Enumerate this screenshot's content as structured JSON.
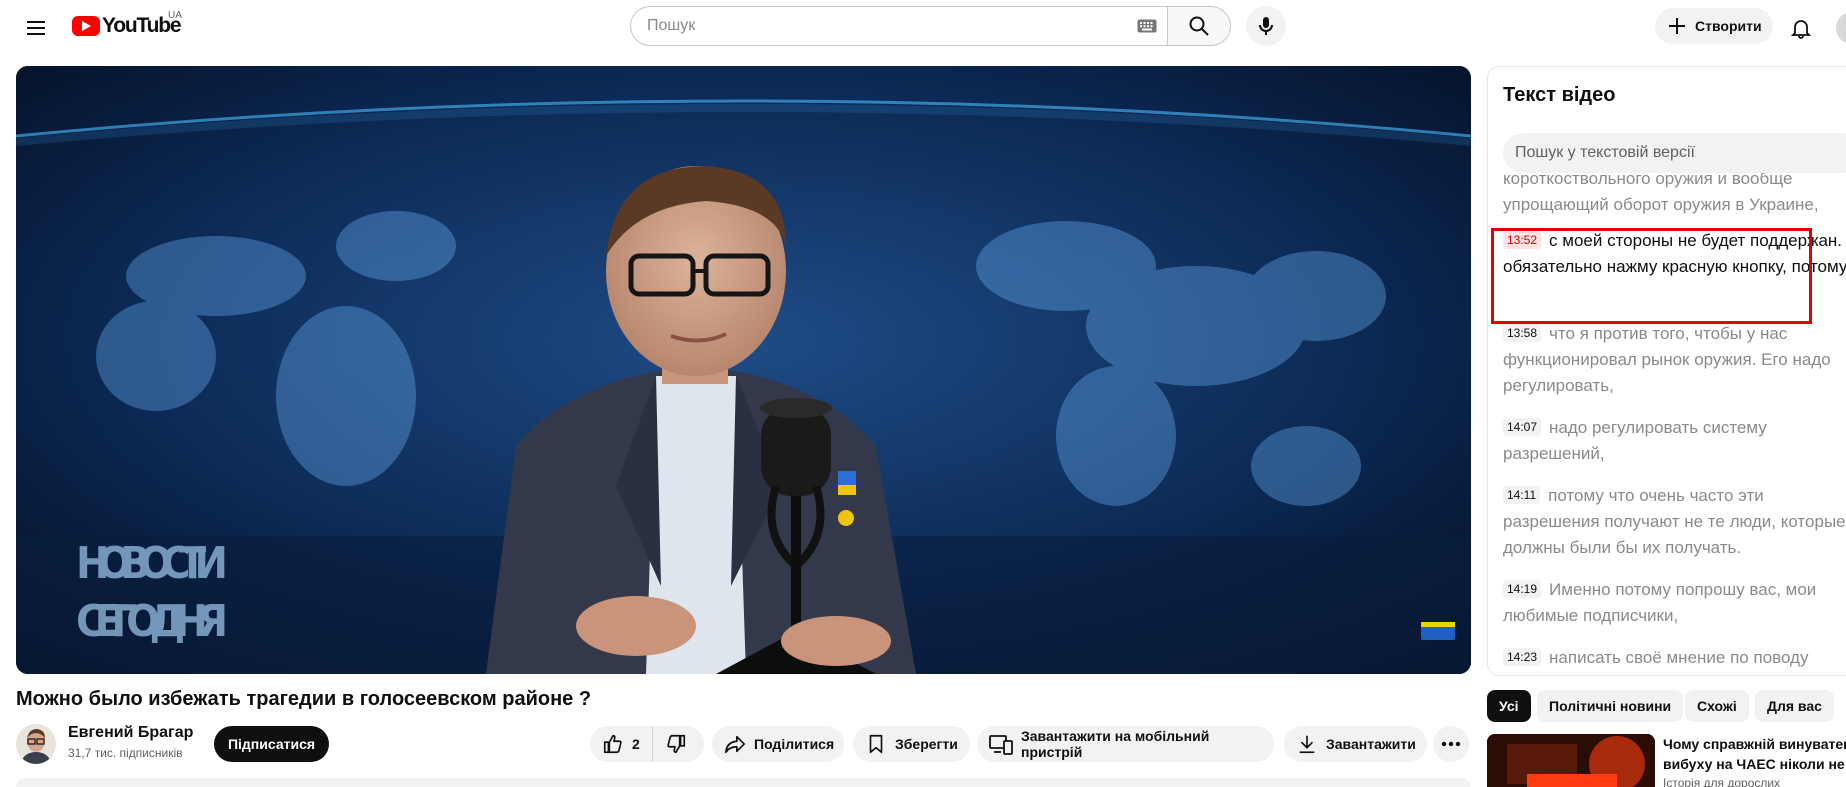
{
  "header": {
    "logo_text": "YouTube",
    "country": "UA",
    "search_placeholder": "Пошук",
    "create_label": "Створити"
  },
  "player": {
    "overlay_line1": "НОВОСТИ",
    "overlay_line2": "СЕГОДНЯ"
  },
  "video": {
    "title": "Можно было избежать трагедии в голосеевском районе ?",
    "channel": "Евгений Брагар",
    "subscribers": "31,7 тис. підписників",
    "subscribe_label": "Підписатися",
    "like_count": "2",
    "share_label": "Поділитися",
    "save_label": "Зберегти",
    "download_mobile_label": "Завантажити на мобільний пристрій",
    "download_label": "Завантажити"
  },
  "transcript": {
    "title": "Текст відео",
    "search_placeholder": "Пошук у текстовій версії",
    "partial_line1": "короткоствольного оружия и вообще",
    "partial_line2": "упрощающий оборот оружия в Украине,",
    "segments": [
      {
        "time": "13:52",
        "text": "с моей стороны не будет поддержан. Я обязательно нажму красную кнопку, потому",
        "active": true
      },
      {
        "time": "13:58",
        "text": "что я против того, чтобы у нас функционировал рынок оружия. Его надо регулировать,",
        "active": false
      },
      {
        "time": "14:07",
        "text": "надо регулировать систему разрешений,",
        "active": false
      },
      {
        "time": "14:11",
        "text": "потому что очень часто эти разрешения получают не те люди, которые должны были бы их получать.",
        "active": false
      },
      {
        "time": "14:19",
        "text": "Именно потому попрошу вас, мои любимые подписчики,",
        "active": false
      },
      {
        "time": "14:23",
        "text": "написать своё мнение по поводу",
        "active": false
      }
    ]
  },
  "chips": [
    {
      "label": "Усі",
      "active": true
    },
    {
      "label": "Політичні новини",
      "active": false
    },
    {
      "label": "Схожі",
      "active": false
    },
    {
      "label": "Для вас",
      "active": false
    }
  ],
  "recommended": {
    "title_line1": "Чому справжній винуватець",
    "title_line2": "вибуху на ЧАЕС ніколи не ...",
    "channel": "Історія для дорослих"
  },
  "colors": {
    "brand_red": "#ff0000",
    "highlight_border": "#e30000",
    "active_chip": "#0f0f0f"
  }
}
